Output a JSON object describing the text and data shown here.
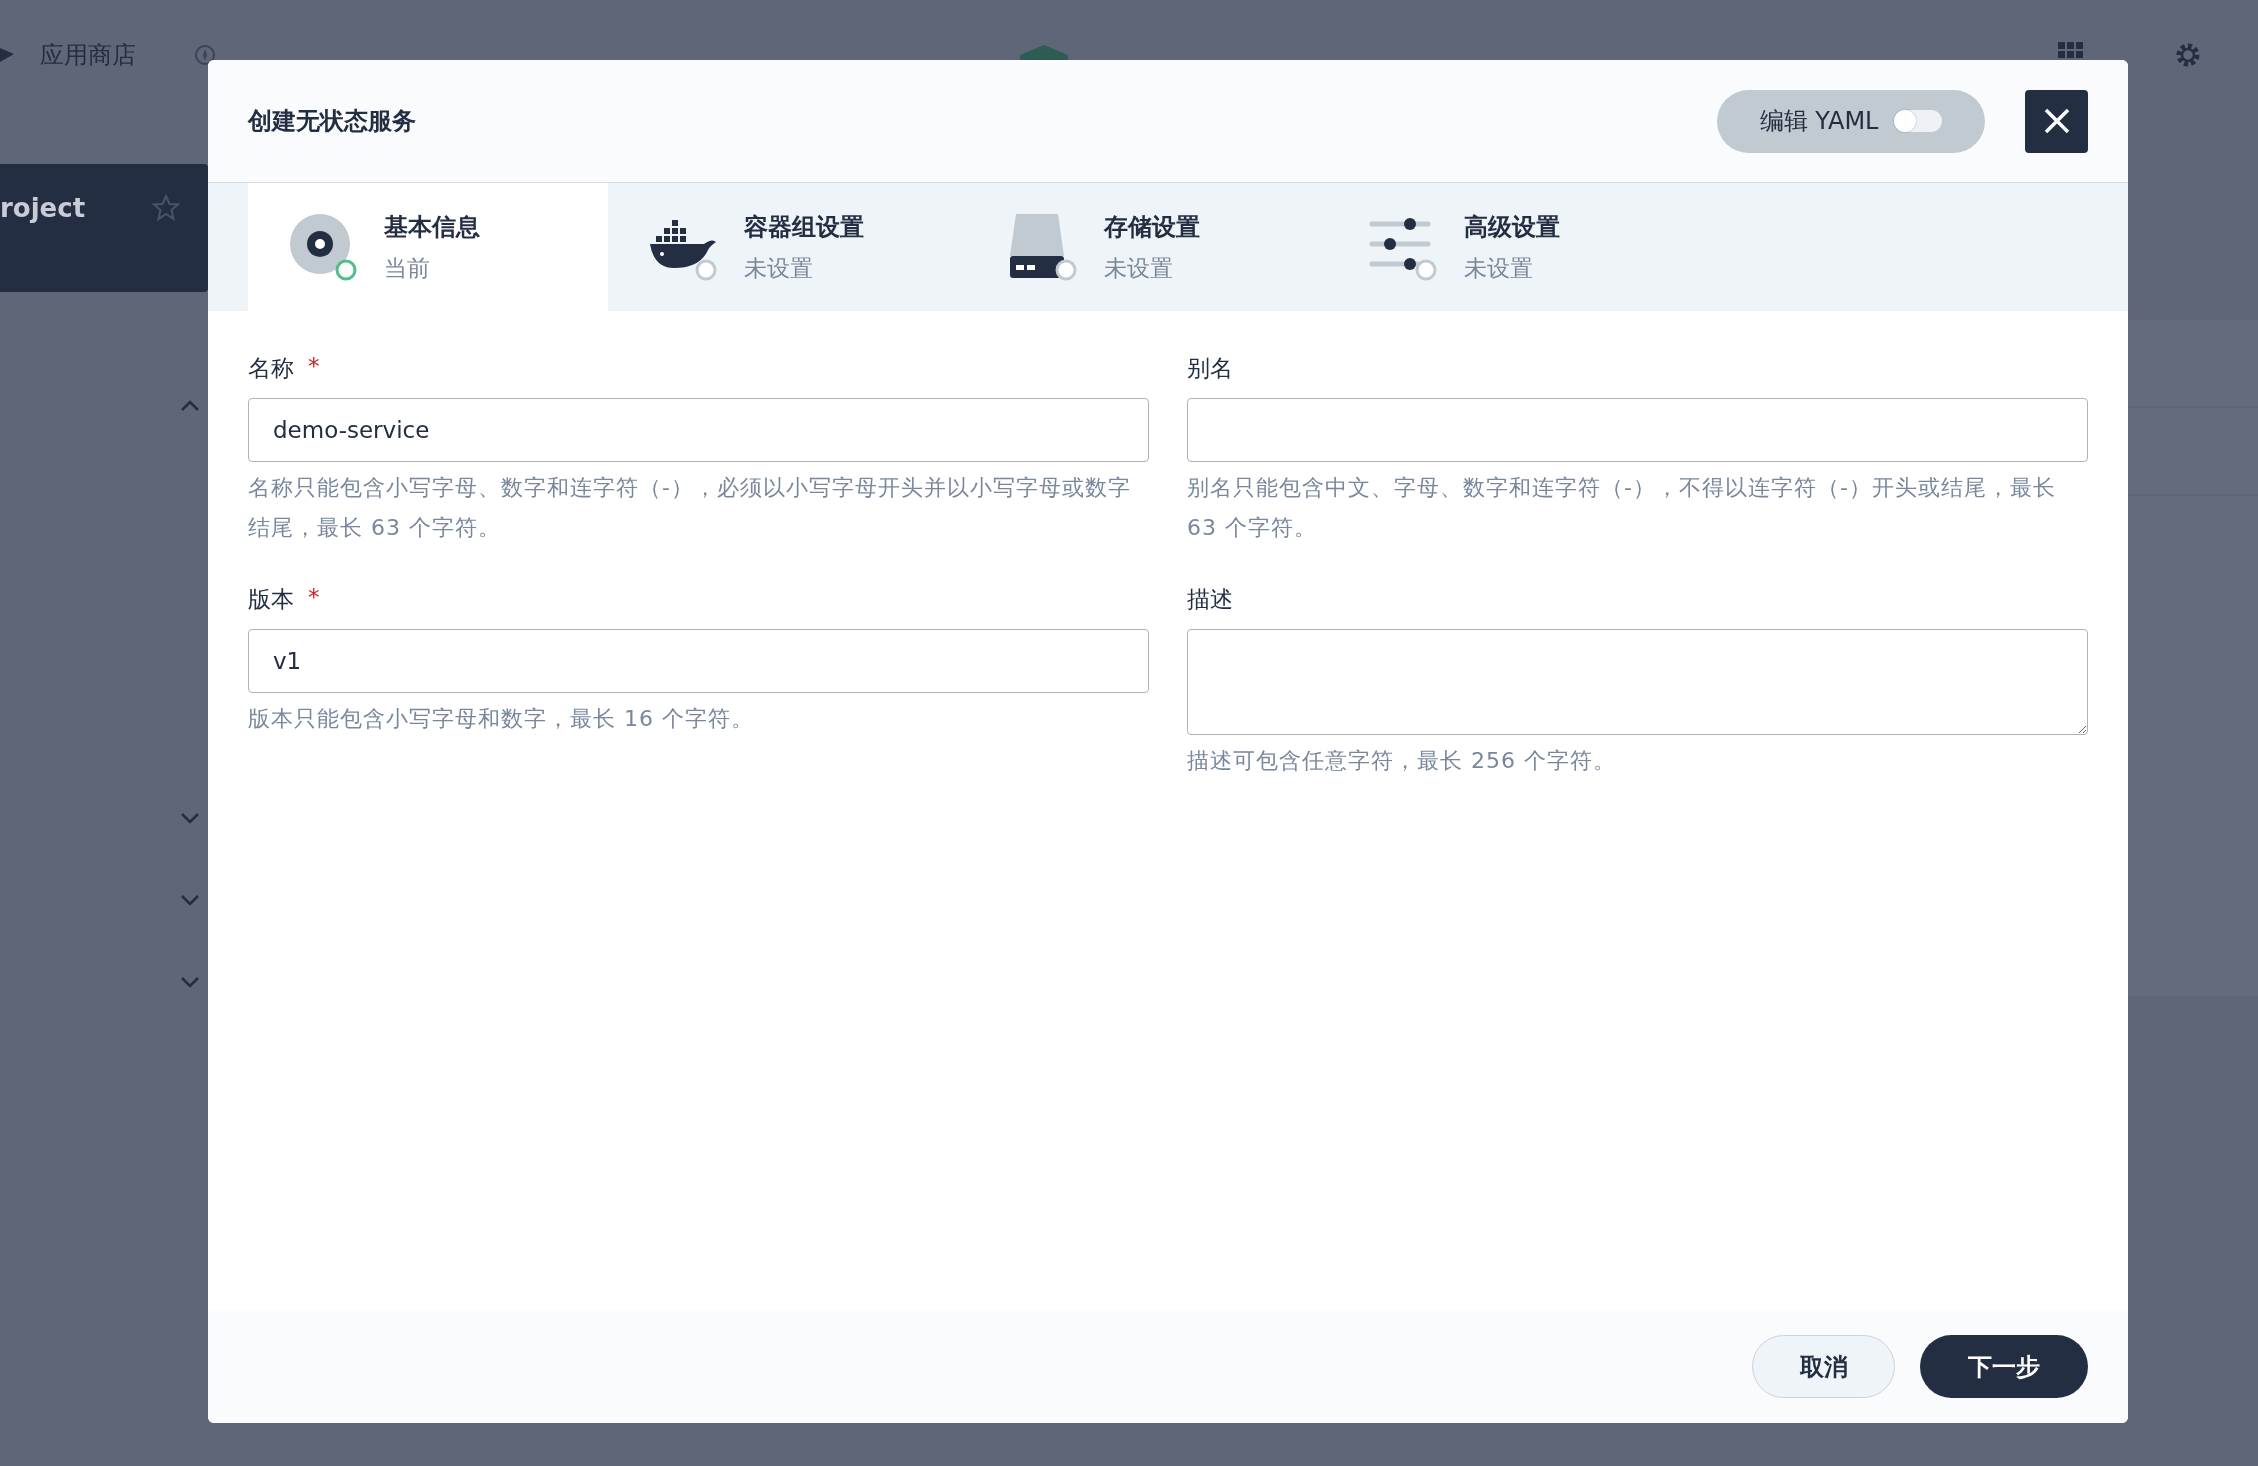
{
  "background": {
    "nav_items": [
      {
        "label": "应用商店",
        "kind": "store"
      }
    ],
    "project_card": {
      "name": "roject"
    }
  },
  "dialog": {
    "title": "创建无状态服务",
    "yaml_toggle": {
      "label": "编辑 YAML",
      "on": false
    },
    "steps": [
      {
        "kind": "info",
        "title": "基本信息",
        "status": "当前",
        "selected": true
      },
      {
        "kind": "containers",
        "title": "容器组设置",
        "status": "未设置",
        "selected": false
      },
      {
        "kind": "storage",
        "title": "存储设置",
        "status": "未设置",
        "selected": false
      },
      {
        "kind": "advanced",
        "title": "高级设置",
        "status": "未设置",
        "selected": false
      }
    ],
    "required_mark": "*",
    "fields": [
      {
        "kind": "input",
        "label": "名称",
        "required": true,
        "value": "demo-service",
        "hint": "名称只能包含小写字母、数字和连字符（-），必须以小写字母开头并以小写字母或数字结尾，最长 63 个字符。"
      },
      {
        "kind": "input",
        "label": "别名",
        "required": false,
        "hint": "别名只能包含中文、字母、数字和连字符（-），不得以连字符（-）开头或结尾，最长 63 个字符。"
      },
      {
        "kind": "input",
        "label": "版本",
        "required": true,
        "value": "v1",
        "hint": "版本只能包含小写字母和数字，最长 16 个字符。"
      },
      {
        "kind": "textarea",
        "label": "描述",
        "required": false,
        "hint": "描述可包含任意字符，最长 256 个字符。"
      }
    ],
    "buttons": [
      {
        "kind": "secondary",
        "label": "取消"
      },
      {
        "kind": "primary",
        "label": "下一步"
      }
    ]
  }
}
